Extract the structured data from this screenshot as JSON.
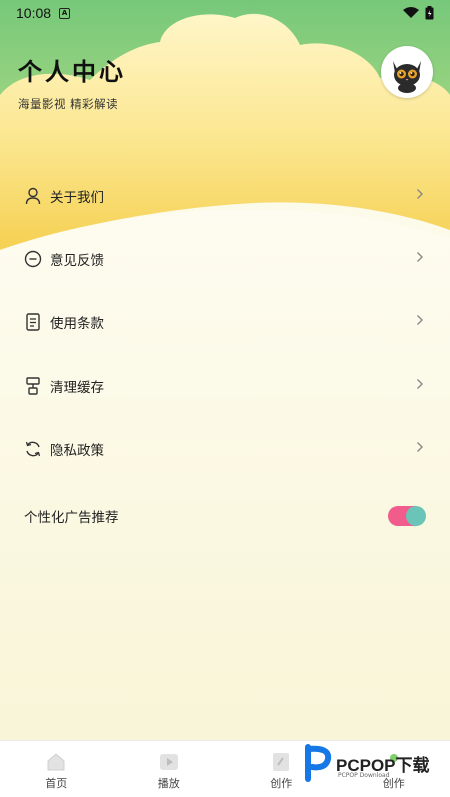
{
  "status_bar": {
    "time": "10:08",
    "notification_icon": "A"
  },
  "header": {
    "title": "个人中心",
    "subtitle": "海量影视 精彩解读"
  },
  "menu": {
    "items": [
      {
        "label": "关于我们",
        "icon": "user-icon"
      },
      {
        "label": "意见反馈",
        "icon": "chat-icon"
      },
      {
        "label": "使用条款",
        "icon": "document-icon"
      },
      {
        "label": "清理缓存",
        "icon": "brush-icon"
      },
      {
        "label": "隐私政策",
        "icon": "refresh-icon"
      }
    ]
  },
  "settings": {
    "personalized_ads_label": "个性化广告推荐",
    "personalized_ads_enabled": true
  },
  "bottom_nav": {
    "items": [
      {
        "label": "首页",
        "icon": "home-icon"
      },
      {
        "label": "播放",
        "icon": "play-icon"
      },
      {
        "label": "创作",
        "icon": "create-icon"
      },
      {
        "label": "创作",
        "icon": "create-icon"
      }
    ]
  },
  "watermark": {
    "brand": "PCPOP下载",
    "sub": "PCPOP Download"
  },
  "colors": {
    "green_top": "#8fd27d",
    "yellow_band": "#f7d75e",
    "cream_bg": "#fbf8e3",
    "toggle_on": "#f05c8b",
    "toggle_knob": "#6ac4b8"
  }
}
